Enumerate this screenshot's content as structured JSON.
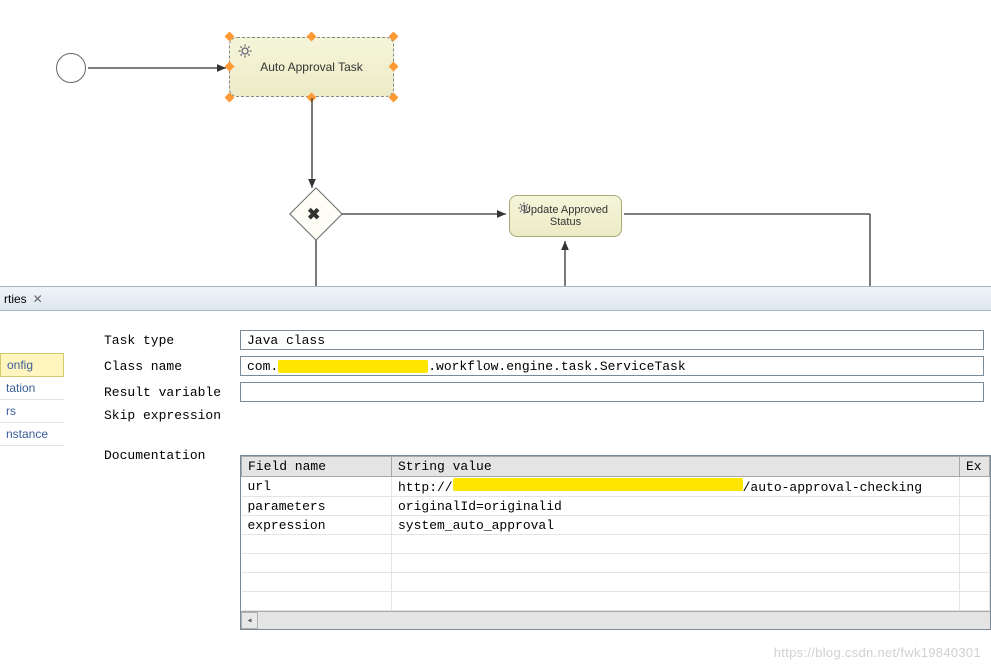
{
  "diagram": {
    "task1_label": "Auto Approval Task",
    "task2_label": "Update Approved Status"
  },
  "panel": {
    "tab_title": "rties",
    "side_tabs": [
      "onfig",
      "tation",
      "rs",
      "nstance"
    ],
    "labels": {
      "task_type": "Task type",
      "class_name": "Class name",
      "result_var": "Result variable",
      "skip_expr": "Skip expression",
      "documentation": "Documentation"
    },
    "values": {
      "task_type": "Java class",
      "class_prefix": "com.",
      "class_suffix": ".workflow.engine.task.ServiceTask",
      "result_var": "",
      "skip_expr": "",
      "documentation": ""
    },
    "fields_table": {
      "headers": [
        "Field name",
        "String value",
        "Ex"
      ],
      "rows": [
        {
          "name": "url",
          "value_prefix": "http://",
          "value_suffix": "/auto-approval-checking",
          "redacted": true
        },
        {
          "name": "parameters",
          "value": "originalId=originalid"
        },
        {
          "name": "expression",
          "value": "system_auto_approval"
        }
      ]
    }
  },
  "watermark": "https://blog.csdn.net/fwk19840301"
}
